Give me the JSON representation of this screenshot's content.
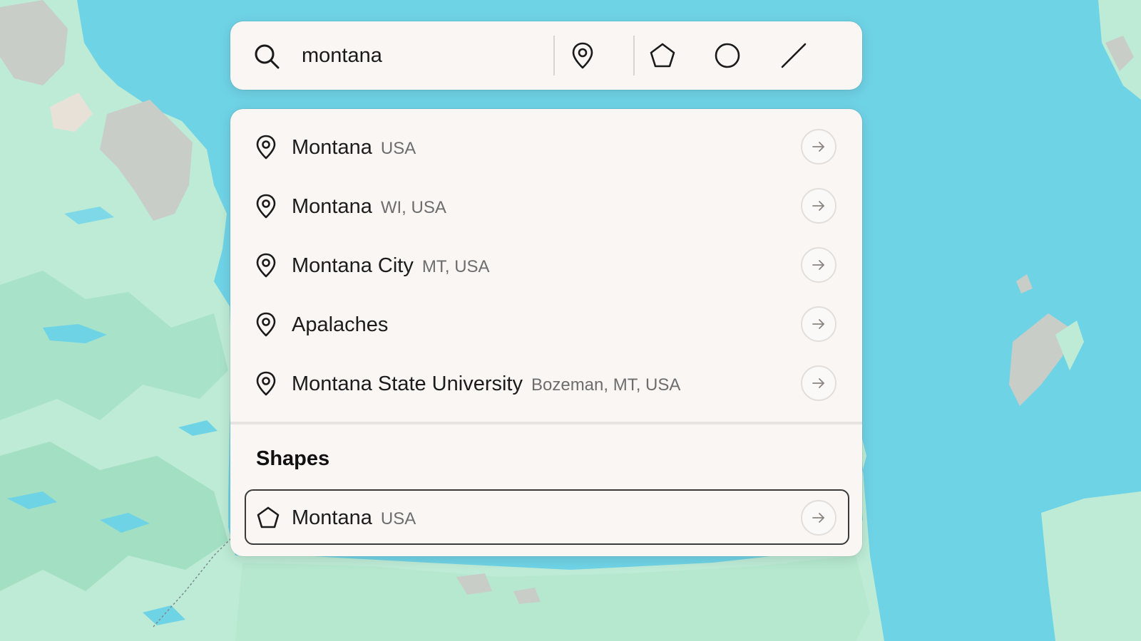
{
  "map": {
    "water_color": "#6fd3e6",
    "land_color": "#bdebd6",
    "land_alt_color": "#9fe0c4",
    "urban_color": "#c9cdc8"
  },
  "search": {
    "value": "montana",
    "icon": "search-icon"
  },
  "tools": [
    {
      "icon": "pin-icon",
      "name": "place-marker"
    },
    {
      "icon": "pentagon-icon",
      "name": "polygon"
    },
    {
      "icon": "circle-icon",
      "name": "circle"
    },
    {
      "icon": "line-icon",
      "name": "line"
    }
  ],
  "results": [
    {
      "name": "Montana",
      "sub": "USA",
      "icon": "pin-icon"
    },
    {
      "name": "Montana",
      "sub": "WI, USA",
      "icon": "pin-icon"
    },
    {
      "name": "Montana City",
      "sub": "MT, USA",
      "icon": "pin-icon"
    },
    {
      "name": "Apalaches",
      "sub": "",
      "icon": "pin-icon"
    },
    {
      "name": "Montana State University",
      "sub": "Bozeman, MT, USA",
      "icon": "pin-icon"
    }
  ],
  "shapes": {
    "title": "Shapes",
    "items": [
      {
        "name": "Montana",
        "sub": "USA",
        "icon": "pentagon-icon"
      }
    ]
  },
  "colors": {
    "panel": "#f9f6f3",
    "text": "#1c1c1c",
    "muted": "#6d6d6d"
  }
}
